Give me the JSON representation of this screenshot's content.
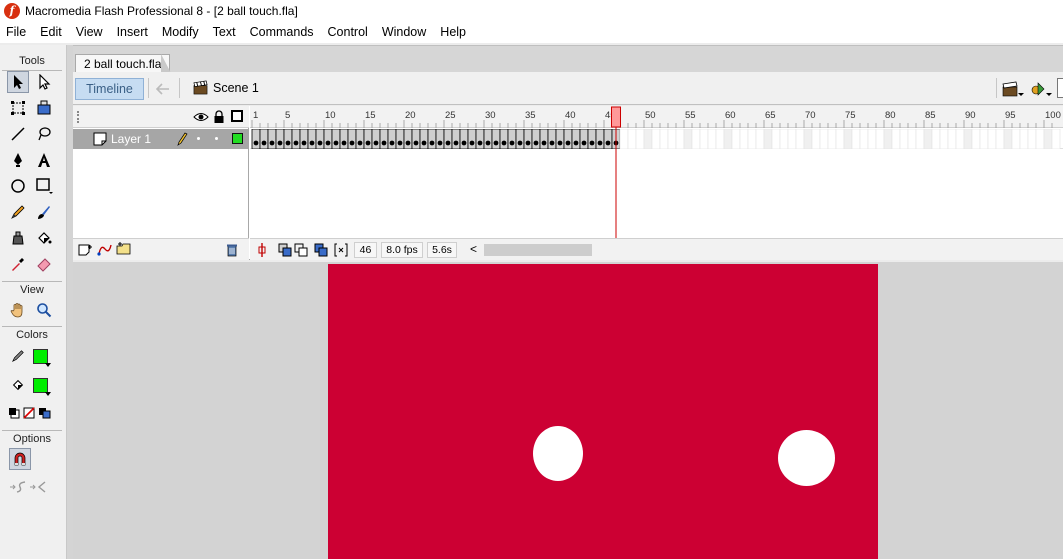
{
  "window": {
    "title": "Macromedia Flash Professional 8 - [2 ball touch.fla]",
    "app_icon_glyph": "f"
  },
  "menu": [
    "File",
    "Edit",
    "View",
    "Insert",
    "Modify",
    "Text",
    "Commands",
    "Control",
    "Window",
    "Help"
  ],
  "tools_panel": {
    "header": "Tools",
    "view_header": "View",
    "colors_header": "Colors",
    "options_header": "Options",
    "stroke_color": "#00ee00",
    "fill_color": "#00ee00"
  },
  "document_tab": {
    "label": "2 ball touch.fla"
  },
  "edit_bar": {
    "timeline_label": "Timeline",
    "scene_label": "Scene 1"
  },
  "timeline": {
    "layer_name": "Layer 1",
    "ruler_labels": [
      "1",
      "5",
      "10",
      "15",
      "20",
      "25",
      "30",
      "35",
      "40",
      "45",
      "50",
      "55",
      "60",
      "65",
      "70",
      "75",
      "80",
      "85",
      "90",
      "95",
      "100"
    ],
    "filled_frame_count": 46,
    "total_visible_frames": 101,
    "current_frame": "46",
    "frame_rate": "8.0 fps",
    "elapsed_time": "5.6s",
    "scroll_left_glyph": "<"
  },
  "stage": {
    "background_color": "#cc0033",
    "balls": [
      {
        "name": "ball-left",
        "color": "#ffffff"
      },
      {
        "name": "ball-right",
        "color": "#ffffff"
      }
    ]
  },
  "colors": {
    "layer_outline": "#22dd22",
    "playhead": "#cc0000",
    "timeline_button_bg": "#c6dcf2"
  }
}
